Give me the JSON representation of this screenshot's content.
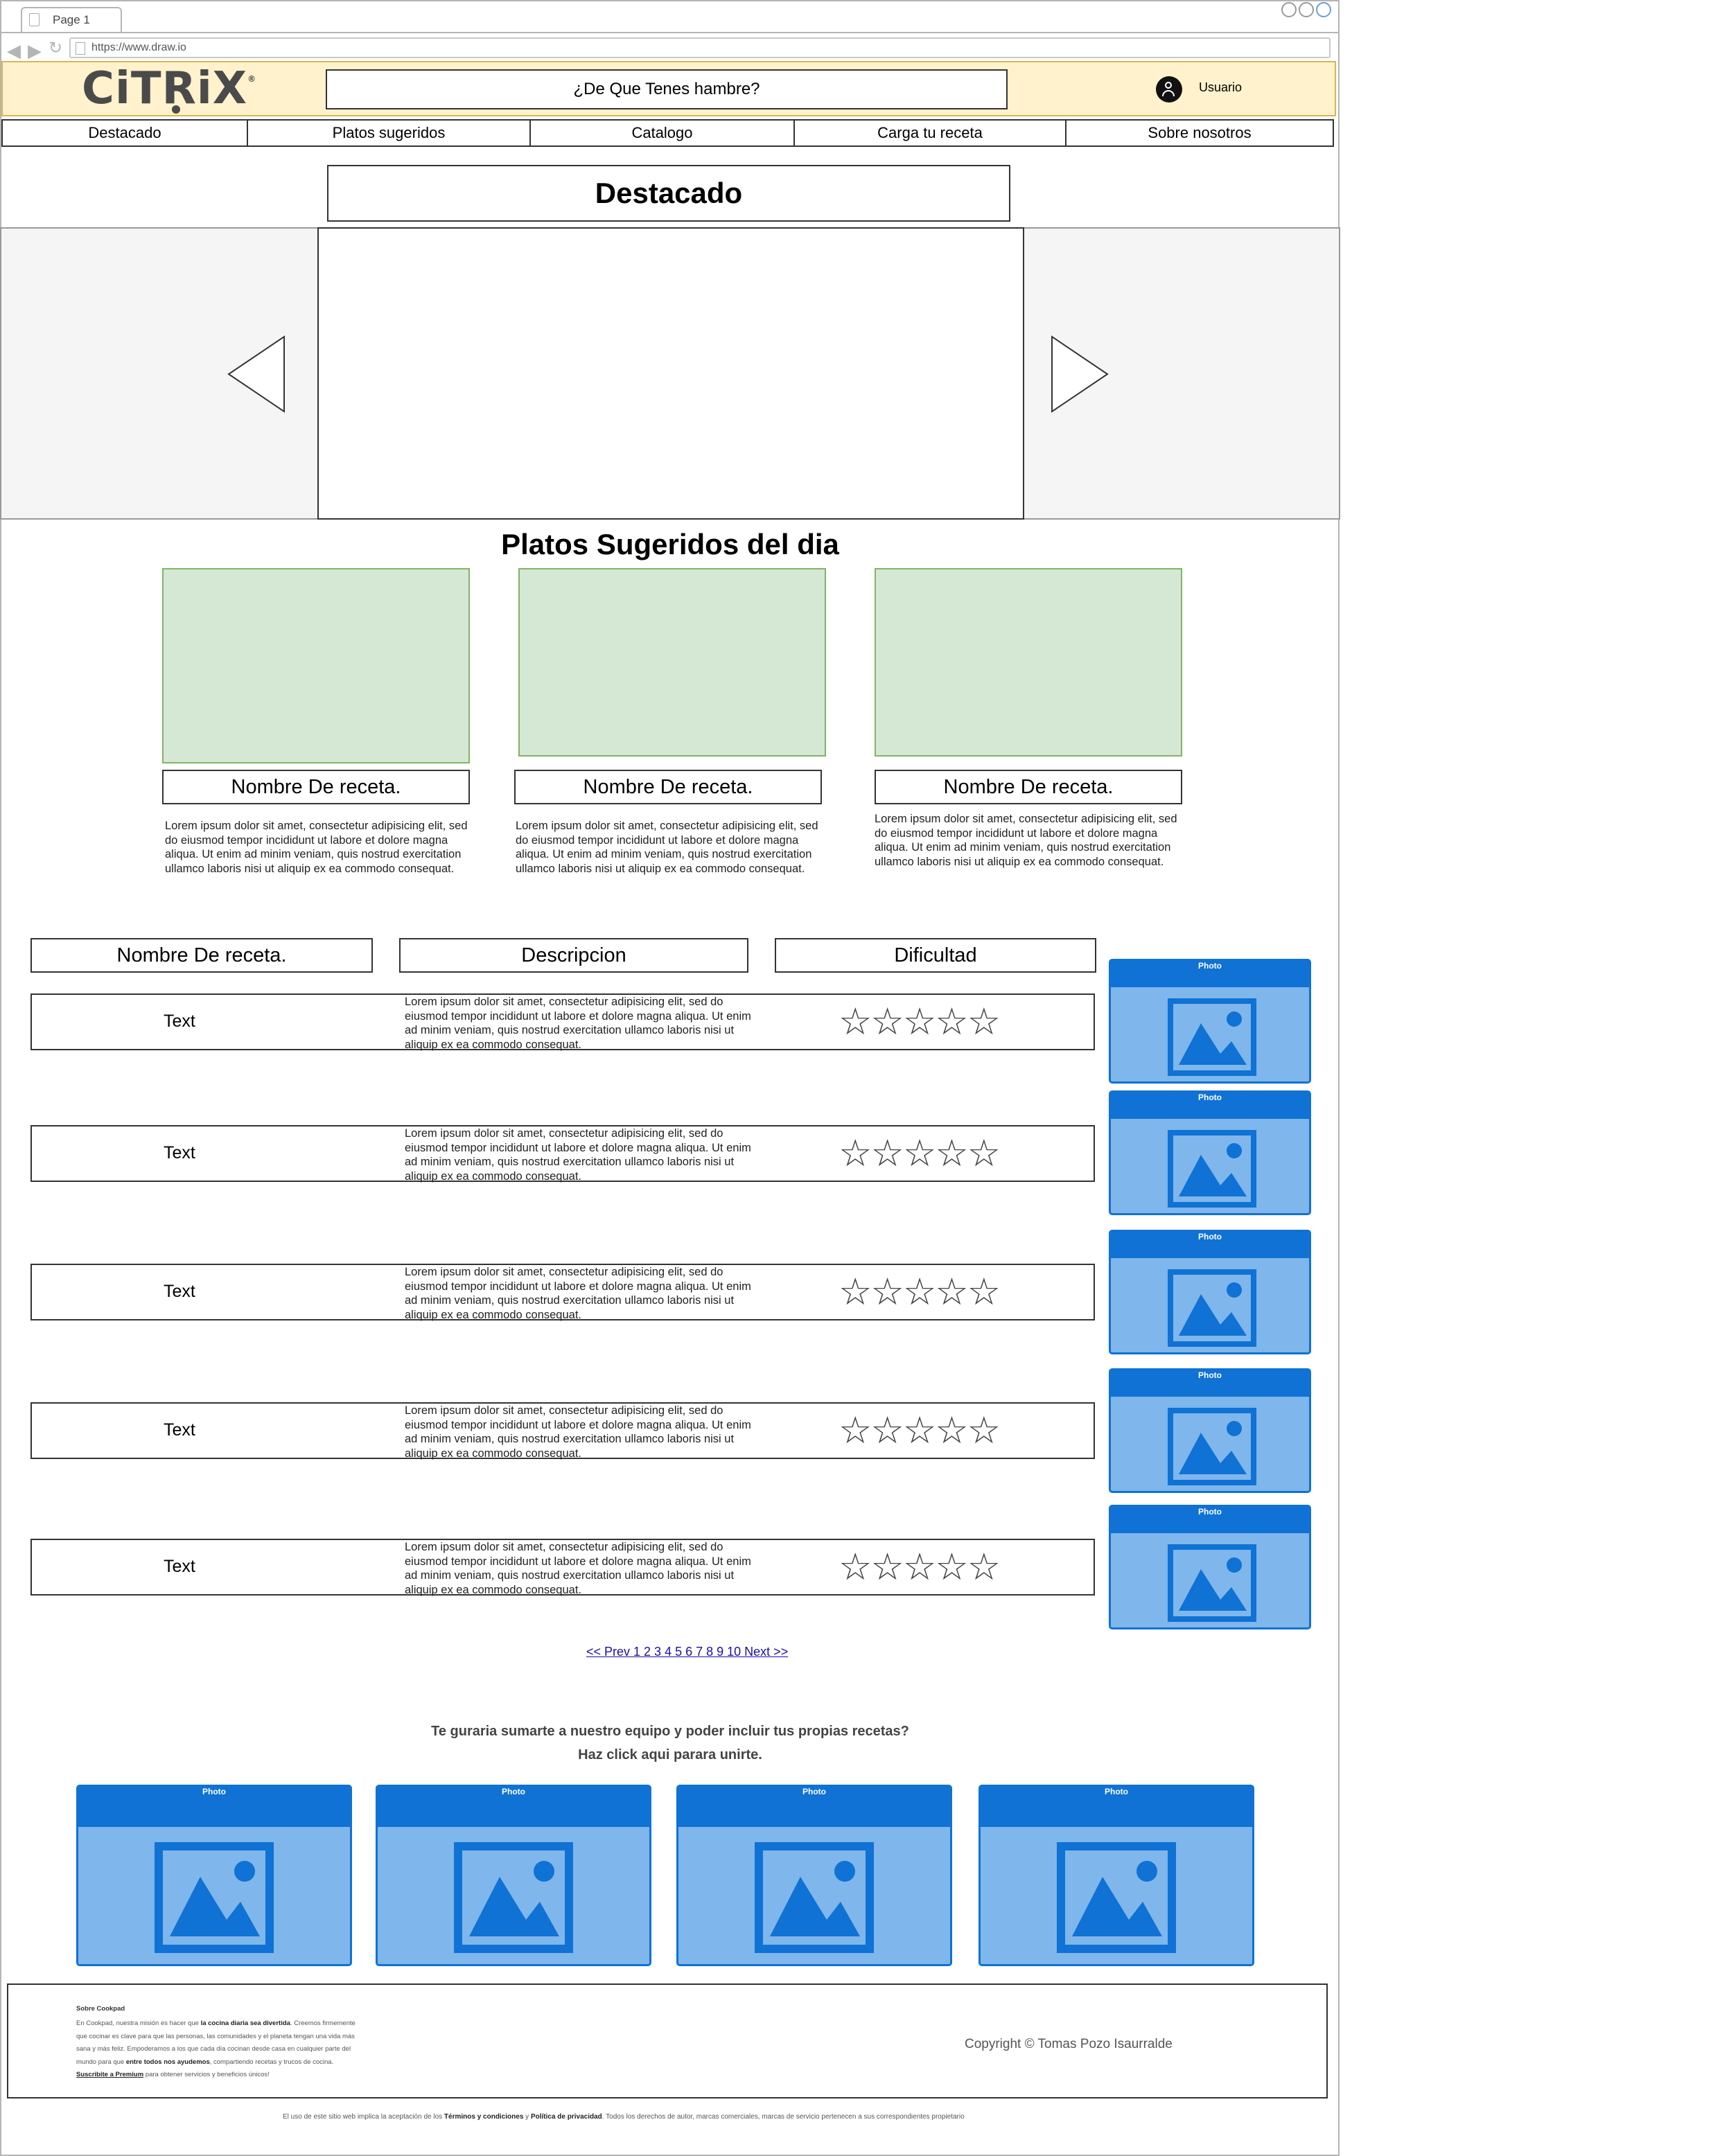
{
  "browser": {
    "tab_title": "Page 1",
    "url": "https://www.draw.io"
  },
  "header": {
    "logo_text": "CiTRiX",
    "logo_mark": "®",
    "search_text": "¿De Que Tenes hambre?",
    "user_label": "Usuario",
    "bg_color": "#fff2cc"
  },
  "nav": {
    "tabs": [
      "Destacado",
      "Platos sugeridos",
      "Catalogo",
      "Carga tu receta",
      "Sobre nosotros"
    ]
  },
  "featured": {
    "title": "Destacado",
    "prev_icon": "triangle-left-icon",
    "next_icon": "triangle-right-icon"
  },
  "suggested": {
    "title": "Platos Sugeridos del dia",
    "cards": [
      {
        "name": "Nombre De receta.",
        "text": "Lorem ipsum dolor sit amet, consectetur adipisicing elit, sed do eiusmod tempor incididunt ut labore et dolore magna aliqua. Ut enim ad minim veniam, quis nostrud exercitation ullamco laboris nisi ut aliquip ex ea commodo consequat."
      },
      {
        "name": "Nombre De receta.",
        "text": "Lorem ipsum dolor sit amet, consectetur adipisicing elit, sed do eiusmod tempor incididunt ut labore et dolore magna aliqua. Ut enim ad minim veniam, quis nostrud exercitation ullamco laboris nisi ut aliquip ex ea commodo consequat."
      },
      {
        "name": "Nombre De receta.",
        "text": "Lorem ipsum dolor sit amet, consectetur adipisicing elit, sed do eiusmod tempor incididunt ut labore et dolore magna aliqua. Ut enim ad minim veniam, quis nostrud exercitation ullamco laboris nisi ut aliquip ex ea commodo consequat."
      }
    ],
    "image_color": "#d5e8d4"
  },
  "table": {
    "headers": [
      "Nombre De receta.",
      "Descripcion",
      "Dificultad"
    ],
    "rows": [
      {
        "name": "Text",
        "desc": "Lorem ipsum dolor sit amet, consectetur adipisicing elit, sed do eiusmod tempor incididunt ut labore et dolore magna aliqua. Ut enim ad minim veniam, quis nostrud exercitation ullamco laboris nisi ut aliquip ex ea commodo consequat.",
        "stars": "☆☆☆☆☆",
        "rating": 0
      },
      {
        "name": "Text",
        "desc": "Lorem ipsum dolor sit amet, consectetur adipisicing elit, sed do eiusmod tempor incididunt ut labore et dolore magna aliqua. Ut enim ad minim veniam, quis nostrud exercitation ullamco laboris nisi ut aliquip ex ea commodo consequat.",
        "stars": "☆☆☆☆☆",
        "rating": 0
      },
      {
        "name": "Text",
        "desc": "Lorem ipsum dolor sit amet, consectetur adipisicing elit, sed do eiusmod tempor incididunt ut labore et dolore magna aliqua. Ut enim ad minim veniam, quis nostrud exercitation ullamco laboris nisi ut aliquip ex ea commodo consequat.",
        "stars": "☆☆☆☆☆",
        "rating": 0
      },
      {
        "name": "Text",
        "desc": "Lorem ipsum dolor sit amet, consectetur adipisicing elit, sed do eiusmod tempor incididunt ut labore et dolore magna aliqua. Ut enim ad minim veniam, quis nostrud exercitation ullamco laboris nisi ut aliquip ex ea commodo consequat.",
        "stars": "☆☆☆☆☆",
        "rating": 0
      },
      {
        "name": "Text",
        "desc": "Lorem ipsum dolor sit amet, consectetur adipisicing elit, sed do eiusmod tempor incididunt ut labore et dolore magna aliqua. Ut enim ad minim veniam, quis nostrud exercitation ullamco laboris nisi ut aliquip ex ea commodo consequat.",
        "stars": "☆☆☆☆☆",
        "rating": 0
      }
    ],
    "photo_label": "Photo"
  },
  "pagination": {
    "text": "<< Prev 1 2 3 4 5 6 7 8 9 10 Next >>"
  },
  "cta": {
    "line1": "Te guraria sumarte a nuestro equipo y poder incluir tus propias recetas?",
    "line2": "Haz click aqui parara unirte.",
    "photo_label": "Photo"
  },
  "footer": {
    "about_title": "Sobre Cookpad",
    "about_line1_a": "En Cookpad, nuestra misión es hacer que ",
    "about_line1_b": "la cocina diaria sea divertida",
    "about_line1_c": ". Creemos firmemente",
    "about_line2": "que cocinar es clave para que las personas, las comunidades y el planeta tengan una vida más",
    "about_line3": "sana y más feliz. Empoderamos a los que cada día cocinan desde casa en cualquier parte del",
    "about_line4_a": "mundo para que ",
    "about_line4_b": "entre todos nos ayudemos",
    "about_line4_c": ", compartiendo recetas y trucos de cocina.",
    "about_line5_a": "Suscribite a Premium",
    "about_line5_b": " para obtener servicios y beneficios únicos!",
    "copyright": "Copyright © Tomas Pozo Isaurralde",
    "legal_a": "El uso de este sitio web implica la aceptación de los ",
    "legal_b": "Términos y condiciones",
    "legal_c": " y ",
    "legal_d": "Política de privacidad",
    "legal_e": ". Todos los derechos de autor, marcas comerciales, marcas de servicio pertenecen a sus correspondientes propietario"
  },
  "colors": {
    "photo_fill": "#7fb6eb",
    "photo_accent": "#0f72d4",
    "link": "#1a0dab"
  }
}
